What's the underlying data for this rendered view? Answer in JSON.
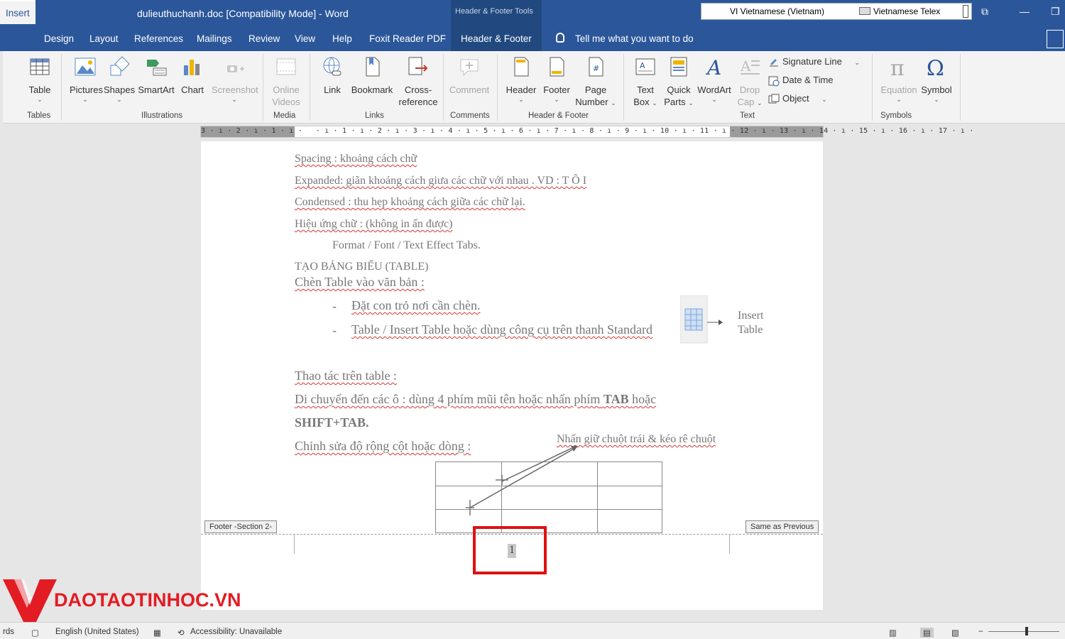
{
  "titlebar": {
    "doc_title": "dulieuthuchanh.doc [Compatibility Mode]  -  Word",
    "contextual_tools": "Header & Footer Tools",
    "lang_input": "VI  Vietnamese (Vietnam)",
    "keyboard": "Vietnamese Telex"
  },
  "tabs": [
    {
      "label": "Insert",
      "active": true
    },
    {
      "label": "Design"
    },
    {
      "label": "Layout"
    },
    {
      "label": "References"
    },
    {
      "label": "Mailings"
    },
    {
      "label": "Review"
    },
    {
      "label": "View"
    },
    {
      "label": "Help"
    },
    {
      "label": "Foxit Reader PDF"
    },
    {
      "label": "Header & Footer"
    }
  ],
  "tell_me": "Tell me what you want to do",
  "ribbon": {
    "table": "Table",
    "pictures": "Pictures",
    "shapes": "Shapes",
    "smartart": "SmartArt",
    "chart": "Chart",
    "screenshot": "Screenshot",
    "online_videos_1": "Online",
    "online_videos_2": "Videos",
    "link": "Link",
    "bookmark": "Bookmark",
    "cross_ref_1": "Cross-",
    "cross_ref_2": "reference",
    "comment": "Comment",
    "header": "Header",
    "footer": "Footer",
    "page_number_1": "Page",
    "page_number_2": "Number",
    "text_box_1": "Text",
    "text_box_2": "Box",
    "quick_parts_1": "Quick",
    "quick_parts_2": "Parts",
    "wordart": "WordArt",
    "drop_cap_1": "Drop",
    "drop_cap_2": "Cap",
    "signature_line": "Signature Line",
    "date_time": "Date & Time",
    "object": "Object",
    "equation": "Equation",
    "symbol": "Symbol",
    "groups": {
      "tables": "Tables",
      "illustrations": "Illustrations",
      "media": "Media",
      "links": "Links",
      "comments": "Comments",
      "header_footer": "Header & Footer",
      "text": "Text",
      "symbols": "Symbols"
    }
  },
  "ruler_text": "3 · ı · 2 · ı · 1 · ı ·   · ı · 1 · ı · 2 · ı · 3 · ı · 4 · ı · 5 · ı · 6 · ı · 7 · ı · 8 · ı · 9 · ı · 10 · ı · 11 · ı · 12 · ı · 13 · ı · 14 · ı · 15 · ı · 16 · ı · 17 · ı ·",
  "doc": {
    "spacing": "Spacing : khoảng cách chữ",
    "expanded": "Expanded: giãn khoảng cách giưa các chữ với nhau . VD : T  Ô     I",
    "condensed": "Condensed : thu hẹp khoảng cách giữa các chữ lại.",
    "effect": "Hiệu ứng chữ : (không in ấn được)",
    "format": "Format / Font / Text Effect Tabs.",
    "heading": "TẠO BẢNG BIỂU (TABLE)",
    "insert_table": "Chèn Table vào văn bản :",
    "bullet1": "Đặt con trỏ nơi cần chèn.",
    "bullet2": "Table / Insert Table hoặc dùng công cụ trên thanh Standard",
    "bullet_mark": "-",
    "insert_label_1": "Insert",
    "insert_label_2": "Table",
    "operations": "Thao tác trên table :",
    "move_1": "Di chuyển đến các ô : dùng 4 phím mũi tên hoặc nhấn phím",
    "move_tab": "TAB",
    "move_2": "hoặc",
    "shift_tab": "SHIFT+TAB.",
    "resize": "Chỉnh sửa độ rộng cột hoặc dòng :",
    "drag_note": "Nhấn giữ chuột trái & kéo rê chuột"
  },
  "footer": {
    "section_tag": "Footer -Section 2-",
    "same_as_previous": "Same as Previous",
    "page_number": "1"
  },
  "logo": {
    "text": "DAOTAOTINHOC.VN",
    "color": "#e31b23"
  },
  "status": {
    "words": "rds",
    "language": "English (United States)",
    "accessibility": "Accessibility: Unavailable"
  },
  "colors": {
    "brand": "#2b579a",
    "highlight": "#e01010"
  }
}
